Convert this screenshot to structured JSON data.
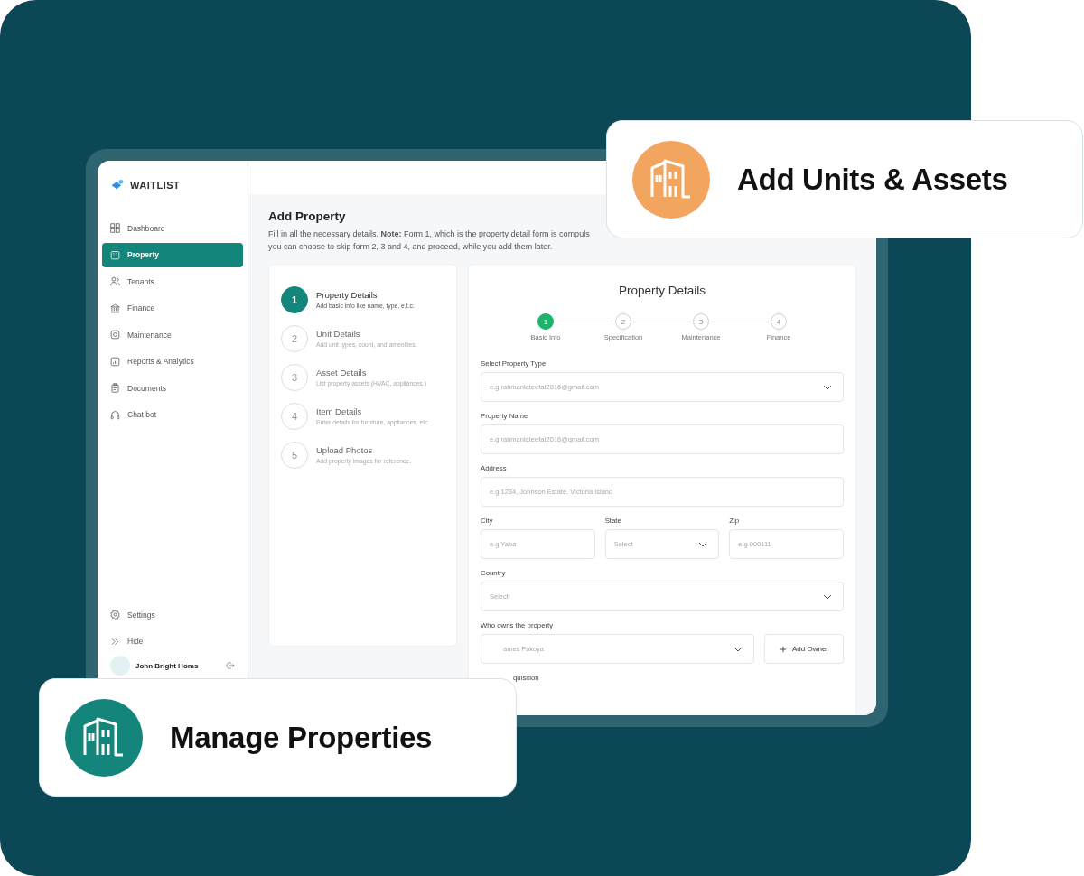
{
  "callouts": [
    {
      "kind": "top",
      "title": "Add Units & Assets",
      "color": "#f2a55f"
    },
    {
      "kind": "bottom",
      "title": "Manage Properties",
      "color": "#14857b"
    }
  ],
  "sidebar": {
    "brand": "WAITLIST",
    "items": [
      {
        "label": "Dashboard",
        "selected": false
      },
      {
        "label": "Property",
        "selected": true
      },
      {
        "label": "Tenants",
        "selected": false
      },
      {
        "label": "Finance",
        "selected": false
      },
      {
        "label": "Maintenance",
        "selected": false
      },
      {
        "label": "Reports & Analytics",
        "selected": false
      },
      {
        "label": "Documents",
        "selected": false
      },
      {
        "label": "Chat bot",
        "selected": false
      }
    ],
    "footer": [
      {
        "label": "Settings"
      },
      {
        "label": "Hide"
      }
    ],
    "user": {
      "name": "John Bright Homs"
    }
  },
  "page": {
    "title": "Add Property",
    "description_lines": [
      "Fill in all the necessary details. **Note:** Form 1, which is the property detail form is compuls",
      "you can choose to skip form 2, 3 and 4, and proceed, while you add them later."
    ]
  },
  "steps": [
    {
      "number": "1",
      "title": "Property Details",
      "subtitle": "Add basic info like name, type, e.t.c.",
      "selected": true
    },
    {
      "number": "2",
      "title": "Unit Details",
      "subtitle": "Add unit types, count, and amenities.",
      "selected": false
    },
    {
      "number": "3",
      "title": "Asset Details",
      "subtitle": "List property assets (HVAC, appliances.)",
      "selected": false
    },
    {
      "number": "4",
      "title": "Item Details",
      "subtitle": "Enter details for furniture, appliances, etc.",
      "selected": false
    },
    {
      "number": "5",
      "title": "Upload Photos",
      "subtitle": "Add property images for reference.",
      "selected": false
    }
  ],
  "form": {
    "title": "Property Details",
    "stepper": [
      {
        "number": "1",
        "label": "Basic Info",
        "selected": true
      },
      {
        "number": "2",
        "label": "Specification",
        "selected": false
      },
      {
        "number": "3",
        "label": "Maintenance",
        "selected": false
      },
      {
        "number": "4",
        "label": "Finance",
        "selected": false
      }
    ],
    "rows": [
      [
        {
          "kind": "select",
          "label": "Select Property Type",
          "placeholder": "e.g rahmanlateefat2016@gmail.com"
        }
      ],
      [
        {
          "kind": "input",
          "label": "Property Name",
          "placeholder": "e.g rahmanlateefat2016@gmail.com"
        }
      ],
      [
        {
          "kind": "input",
          "label": "Address",
          "placeholder": "e.g 1234, Johnson Estate, Victoria Island"
        }
      ],
      [
        {
          "kind": "input",
          "label": "City",
          "placeholder": "e.g Yaba"
        },
        {
          "kind": "select",
          "label": "State",
          "placeholder": "Select"
        },
        {
          "kind": "input",
          "label": "Zip",
          "placeholder": "e.g 000111"
        }
      ],
      [
        {
          "kind": "select",
          "label": "Country",
          "placeholder": "Select"
        }
      ],
      [
        {
          "kind": "select",
          "label": "Who owns the property",
          "placeholder": "ames Fakoya"
        },
        {
          "kind": "button",
          "label": "Add Owner"
        }
      ],
      [
        {
          "kind": "label",
          "label": "quisition"
        }
      ]
    ]
  }
}
